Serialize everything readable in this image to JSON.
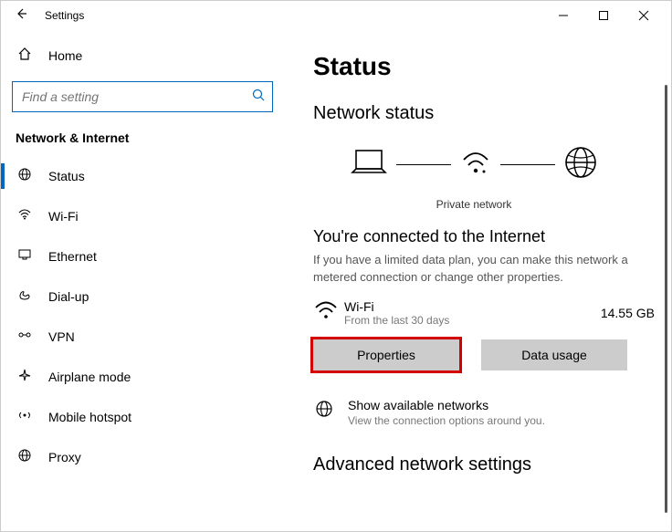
{
  "titlebar": {
    "title": "Settings"
  },
  "sidebar": {
    "home": "Home",
    "search_placeholder": "Find a setting",
    "section": "Network & Internet",
    "items": [
      {
        "label": "Status"
      },
      {
        "label": "Wi-Fi"
      },
      {
        "label": "Ethernet"
      },
      {
        "label": "Dial-up"
      },
      {
        "label": "VPN"
      },
      {
        "label": "Airplane mode"
      },
      {
        "label": "Mobile hotspot"
      },
      {
        "label": "Proxy"
      }
    ]
  },
  "main": {
    "heading": "Status",
    "subheading": "Network status",
    "diagram_caption": "Private network",
    "connected_title": "You're connected to the Internet",
    "connected_desc": "If you have a limited data plan, you can make this network a metered connection or change other properties.",
    "wifi": {
      "name": "Wi-Fi",
      "sub": "From the last 30 days",
      "usage": "14.55 GB"
    },
    "buttons": {
      "properties": "Properties",
      "data_usage": "Data usage"
    },
    "available": {
      "title": "Show available networks",
      "desc": "View the connection options around you."
    },
    "advanced": "Advanced network settings"
  }
}
